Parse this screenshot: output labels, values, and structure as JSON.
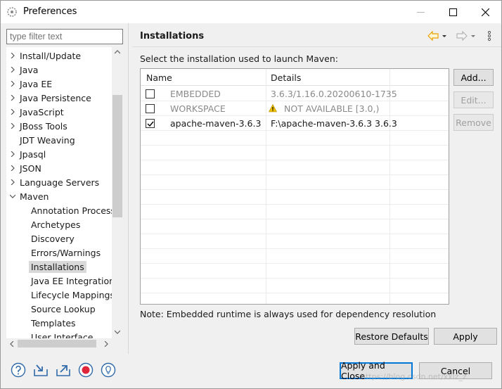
{
  "window": {
    "title": "Preferences"
  },
  "filter": {
    "placeholder": "type filter text"
  },
  "tree": {
    "items": [
      {
        "label": "Install/Update",
        "expander": "collapsed"
      },
      {
        "label": "Java",
        "expander": "collapsed"
      },
      {
        "label": "Java EE",
        "expander": "collapsed"
      },
      {
        "label": "Java Persistence",
        "expander": "collapsed"
      },
      {
        "label": "JavaScript",
        "expander": "collapsed"
      },
      {
        "label": "JBoss Tools",
        "expander": "collapsed"
      },
      {
        "label": "JDT Weaving",
        "expander": "none"
      },
      {
        "label": "Jpasql",
        "expander": "collapsed"
      },
      {
        "label": "JSON",
        "expander": "collapsed"
      },
      {
        "label": "Language Servers",
        "expander": "collapsed"
      },
      {
        "label": "Maven",
        "expander": "expanded"
      },
      {
        "label": "Annotation Process",
        "child": true
      },
      {
        "label": "Archetypes",
        "child": true
      },
      {
        "label": "Discovery",
        "child": true
      },
      {
        "label": "Errors/Warnings",
        "child": true
      },
      {
        "label": "Installations",
        "child": true,
        "selected": true
      },
      {
        "label": "Java EE Integration",
        "child": true
      },
      {
        "label": "Lifecycle Mappings",
        "child": true
      },
      {
        "label": "Source Lookup",
        "child": true
      },
      {
        "label": "Templates",
        "child": true
      },
      {
        "label": "User Interface",
        "child": true
      }
    ]
  },
  "page": {
    "title": "Installations",
    "instruction": "Select the installation used to launch Maven:",
    "columns": {
      "name": "Name",
      "details": "Details"
    },
    "rows": [
      {
        "checked": false,
        "name": "EMBEDDED",
        "details": "3.6.3/1.16.0.20200610-1735",
        "dimmed": true,
        "highlighted": true,
        "warning": false
      },
      {
        "checked": false,
        "name": "WORKSPACE",
        "details": "NOT AVAILABLE [3.0,)",
        "dimmed": true,
        "highlighted": false,
        "warning": true
      },
      {
        "checked": true,
        "name": "apache-maven-3.6.3",
        "details": "F:\\apache-maven-3.6.3 3.6.3",
        "dimmed": false,
        "highlighted": false,
        "warning": false
      }
    ],
    "buttons": {
      "add": "Add...",
      "edit": "Edit...",
      "remove": "Remove"
    },
    "note": "Note: Embedded runtime is always used for dependency resolution",
    "restore_defaults": "Restore Defaults",
    "apply": "Apply"
  },
  "footer": {
    "apply_and_close": "Apply and Close",
    "cancel": "Cancel",
    "icons": [
      "help-icon",
      "import-icon",
      "export-icon",
      "record-icon",
      "tip-icon"
    ]
  },
  "watermark": "https://blog.csdn.net/xxlz_z",
  "colors": {
    "selection": "#cce8ff",
    "accent": "#0078d7",
    "nav_arrow": "#e8a100"
  }
}
